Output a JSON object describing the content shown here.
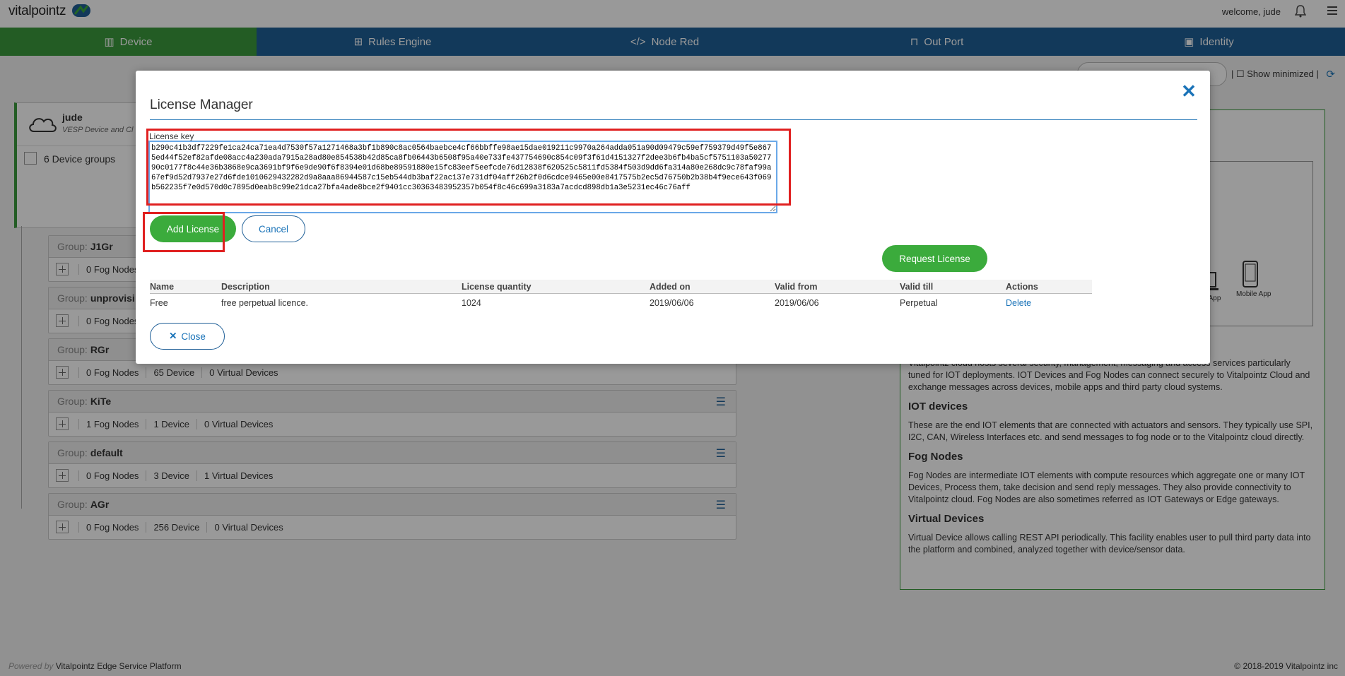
{
  "app": {
    "logo_text": "vitalpointz",
    "welcome": "welcome, jude"
  },
  "nav": {
    "tabs": [
      {
        "label": "Device",
        "icon": "device-icon",
        "active": true
      },
      {
        "label": "Rules Engine",
        "icon": "rules-icon",
        "active": false
      },
      {
        "label": "Node Red",
        "icon": "code-icon",
        "active": false
      },
      {
        "label": "Out Port",
        "icon": "port-icon",
        "active": false
      },
      {
        "label": "Identity",
        "icon": "id-badge-icon",
        "active": false
      }
    ]
  },
  "background": {
    "show_minimized": "Show minimized",
    "user_name": "jude",
    "user_sub": "VESP Device and Cl",
    "device_groups": "6 Device groups",
    "groups": [
      {
        "label": "Group:",
        "name": "J1Gr",
        "stats": [
          "0 Fog Nodes",
          "",
          ""
        ]
      },
      {
        "label": "Group:",
        "name": "unprovisi",
        "stats": [
          "0 Fog Nodes",
          "",
          ""
        ]
      },
      {
        "label": "Group:",
        "name": "RGr",
        "stats": [
          "0 Fog Nodes",
          "65 Device",
          "0 Virtual Devices"
        ]
      },
      {
        "label": "Group:",
        "name": "KiTe",
        "stats": [
          "1 Fog Nodes",
          "1 Device",
          "0 Virtual Devices"
        ]
      },
      {
        "label": "Group:",
        "name": "default",
        "stats": [
          "0 Fog Nodes",
          "3 Device",
          "1 Virtual Devices"
        ]
      },
      {
        "label": "Group:",
        "name": "AGr",
        "stats": [
          "0 Fog Nodes",
          "256 Device",
          "0 Virtual Devices"
        ]
      }
    ],
    "diagram": {
      "web_app": "Web App",
      "mobile_app": "Mobile App"
    },
    "info": {
      "intro": "Vitalpointz cloud hosts several security, management, messaging and access services particularly tuned for IOT deployments. IOT Devices and Fog Nodes can connect securely to Vitalpointz Cloud and exchange messages across devices, mobile apps and third party cloud systems.",
      "iot_title": "IOT devices",
      "iot_text": "These are the end IOT elements that are connected with actuators and sensors. They typically use SPI, I2C, CAN, Wireless Interfaces etc. and send messages to fog node or to the Vitalpointz cloud directly.",
      "fog_title": "Fog Nodes",
      "fog_text": "Fog Nodes are intermediate IOT elements with compute resources which aggregate one or many IOT Devices, Process them, take decision and send reply messages. They also provide connectivity to Vitalpointz cloud. Fog Nodes are also sometimes referred as IOT Gateways or Edge gateways.",
      "virtual_title": "Virtual Devices",
      "virtual_text": "Virtual Device allows calling REST API periodically. This facility enables user to pull third party data into the platform and combined, analyzed together with device/sensor data."
    },
    "footer_powered": "Powered by",
    "footer_platform": "Vitalpointz Edge Service Platform",
    "footer_copyright": "© 2018-2019 Vitalpointz inc"
  },
  "modal": {
    "title": "License Manager",
    "license_key_label": "License key",
    "license_key_value": "b290c41b3df7229fe1ca24ca71ea4d7530f57a1271468a3bf1b890c8ac0564baebce4cf66bbffe98ae15dae019211c9970a264adda051a90d09479c59ef759379d49f5e8675ed44f52ef82afde08acc4a230ada7915a28ad80e854538b42d85ca8fb06443b6508f95a40e733fe437754690c854c09f3f61d4151327f2dee3b6fb4ba5cf5751103a5027790c0177f8c44e36b3868e9ca3691bf9f6e9de90f6f8394e01d68be89591880e15fc83eef5eefcde76d12838f620525c5811fd5384f503d9dd6fa314a80e268dc9c78faf99a67ef9d52d7937e27d6fde1010629432282d9a8aaa86944587c15eb544db3baf22ac137e731df04aff26b2f0d6cdce9465e00e8417575b2ec5d76750b2b38b4f9ece643f069b562235f7e0d570d0c7895d0eab8c99e21dca27bfa4ade8bce2f9401cc30363483952357b054f8c46c699a3183a7acdcd898db1a3e5231ec46c76aff",
    "add_label": "Add License",
    "cancel_label": "Cancel",
    "request_label": "Request License",
    "close_label": "Close",
    "table": {
      "headers": [
        "Name",
        "Description",
        "License quantity",
        "Added on",
        "Valid from",
        "Valid till",
        "Actions"
      ],
      "rows": [
        [
          "Free",
          "free perpetual licence.",
          "1024",
          "2019/06/06",
          "2019/06/06",
          "Perpetual",
          "Delete"
        ]
      ]
    }
  },
  "colors": {
    "accent_green": "#3bab3c",
    "nav_blue": "#1f5f97",
    "highlight_red": "#e02020",
    "link_blue": "#1a73b8"
  }
}
